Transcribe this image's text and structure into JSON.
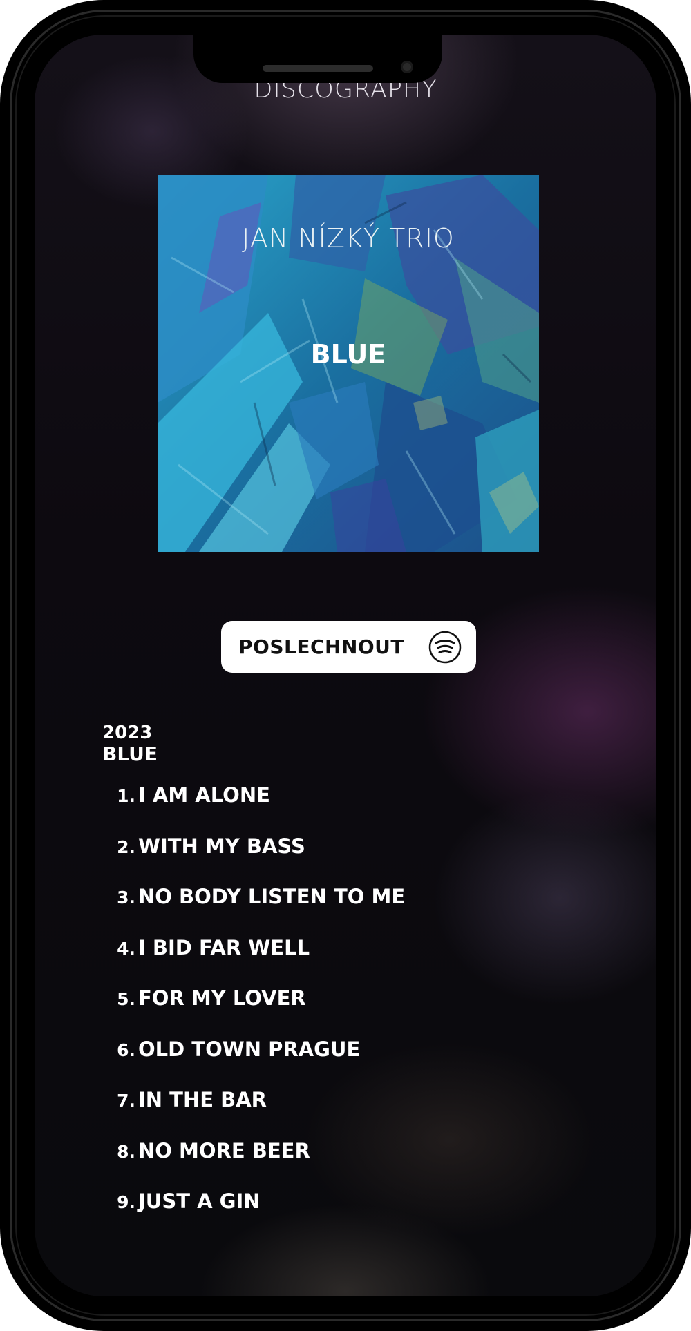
{
  "header": {
    "title": "DISCOGRAPHY"
  },
  "cover": {
    "artist": "JAN NÍZKÝ TRIO",
    "album": "BLUE"
  },
  "listen_button": {
    "label": "POSLECHNOUT",
    "icon": "spotify-icon"
  },
  "album": {
    "year": "2023",
    "name": "BLUE"
  },
  "tracks": [
    {
      "number": "1.",
      "title": "I AM ALONE"
    },
    {
      "number": "2.",
      "title": "WITH MY BASS"
    },
    {
      "number": "3.",
      "title": "NO BODY LISTEN TO ME"
    },
    {
      "number": "4.",
      "title": "I BID FAR WELL"
    },
    {
      "number": "5.",
      "title": "FOR MY LOVER"
    },
    {
      "number": "6.",
      "title": "OLD TOWN PRAGUE"
    },
    {
      "number": "7.",
      "title": "IN THE BAR"
    },
    {
      "number": "8.",
      "title": "NO MORE BEER"
    },
    {
      "number": "9.",
      "title": "JUST A GIN"
    }
  ],
  "colors": {
    "background": "#0d0a10",
    "text": "#ffffff",
    "button_bg": "#ffffff",
    "button_text": "#111111",
    "cover_accent": "#1c8fb8"
  }
}
